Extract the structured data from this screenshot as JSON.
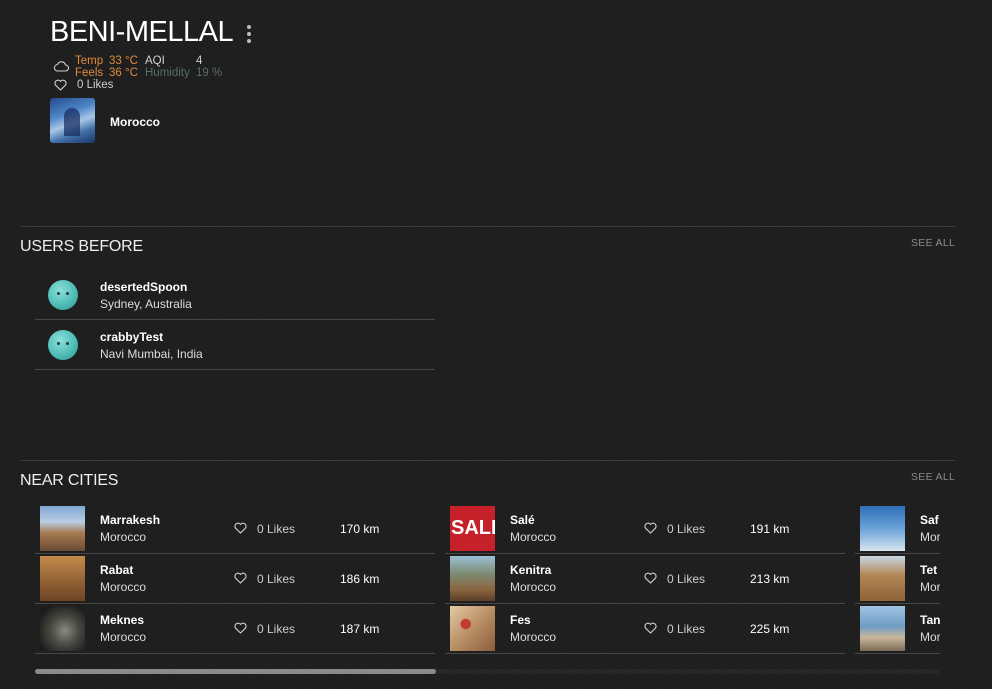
{
  "header": {
    "city": "BENI-MELLAL",
    "weather": {
      "temp_label": "Temp",
      "temp_value": "33 °C",
      "feels_label": "Feels",
      "feels_value": "36 °C",
      "aqi_label": "AQI",
      "aqi_value": "4",
      "humidity_label": "Humidity",
      "humidity_value": "19 %"
    },
    "likes": "0 Likes",
    "country": "Morocco"
  },
  "users_section": {
    "title": "USERS BEFORE",
    "see_all": "SEE ALL",
    "users": [
      {
        "name": "desertedSpoon",
        "location": "Sydney, Australia"
      },
      {
        "name": "crabbyTest",
        "location": "Navi Mumbai, India"
      }
    ]
  },
  "near_section": {
    "title": "NEAR CITIES",
    "see_all": "SEE ALL",
    "columns": [
      [
        {
          "name": "Marrakesh",
          "country": "Morocco",
          "likes": "0 Likes",
          "distance": "170 km"
        },
        {
          "name": "Rabat",
          "country": "Morocco",
          "likes": "0 Likes",
          "distance": "186 km"
        },
        {
          "name": "Meknes",
          "country": "Morocco",
          "likes": "0 Likes",
          "distance": "187 km"
        }
      ],
      [
        {
          "name": "Salé",
          "country": "Morocco",
          "likes": "0 Likes",
          "distance": "191 km",
          "thumb_text": "SALE"
        },
        {
          "name": "Kenitra",
          "country": "Morocco",
          "likes": "0 Likes",
          "distance": "213 km"
        },
        {
          "name": "Fes",
          "country": "Morocco",
          "likes": "0 Likes",
          "distance": "225 km"
        }
      ],
      [
        {
          "name": "Saf",
          "country": "Mor"
        },
        {
          "name": "Tet",
          "country": "Mor"
        },
        {
          "name": "Tan",
          "country": "Mor"
        }
      ]
    ]
  },
  "colors": {
    "background": "#1e1e1e",
    "temp_accent": "#e08a3c",
    "humidity_muted": "#5a6b6e"
  }
}
